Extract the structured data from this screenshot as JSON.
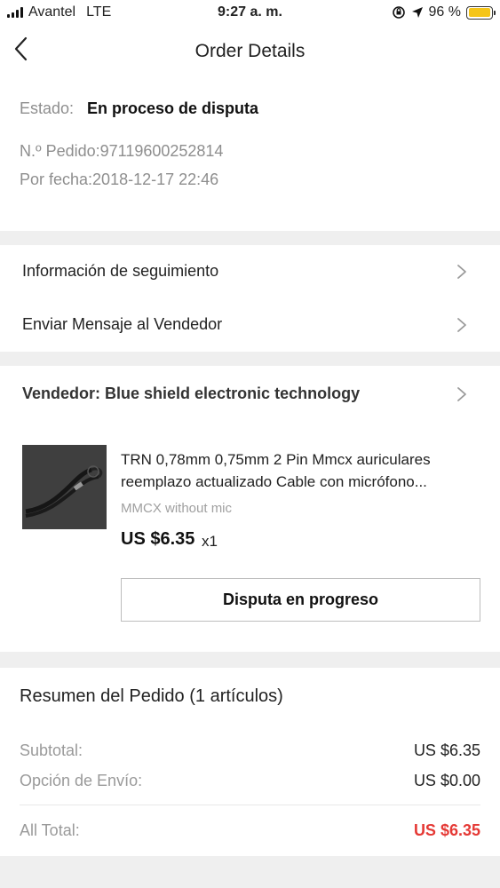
{
  "status_bar": {
    "carrier": "Avantel",
    "network": "LTE",
    "time": "9:27 a. m.",
    "battery_percent": "96 %",
    "battery_level": 0.96,
    "icons": [
      "signal-icon",
      "orientation-lock-icon",
      "location-arrow-icon",
      "battery-icon"
    ]
  },
  "header": {
    "title": "Order Details",
    "back_icon": "chevron-left-icon"
  },
  "order": {
    "estado_label": "Estado:",
    "estado_value": "En proceso de disputa",
    "pedido": "N.º Pedido:97119600252814",
    "fecha": "Por fecha:2018-12-17 22:46"
  },
  "links": [
    {
      "label": "Información de seguimiento",
      "icon": "chevron-right-icon"
    },
    {
      "label": "Enviar Mensaje al Vendedor",
      "icon": "chevron-right-icon"
    }
  ],
  "seller": {
    "label": "Vendedor: Blue shield electronic technology",
    "icon": "chevron-right-icon"
  },
  "product": {
    "title_line1": "TRN 0,78mm 0,75mm 2 Pin Mmcx auriculares",
    "title_line2": "reemplazo actualizado Cable con micrófono...",
    "variant": "MMCX without mic",
    "price": "US $6.35",
    "quantity": "x1",
    "button_label": "Disputa en progreso"
  },
  "summary": {
    "title": "Resumen del Pedido (1 artículos)",
    "subtotal_label": "Subtotal:",
    "subtotal_value": "US $6.35",
    "shipping_label": "Opción de Envío:",
    "shipping_value": "US $0.00",
    "total_label": "All Total:",
    "total_value": "US $6.35",
    "total_color": "#e53935"
  }
}
